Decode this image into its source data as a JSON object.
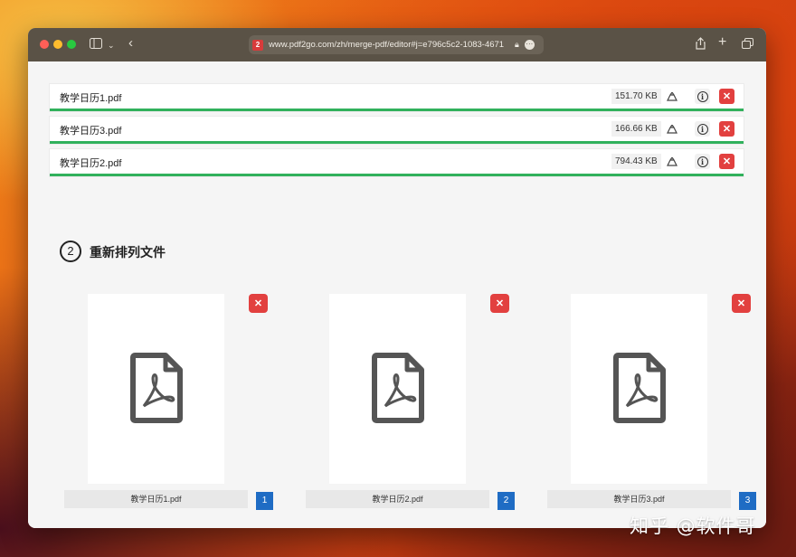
{
  "browser": {
    "url": "www.pdf2go.com/zh/merge-pdf/editor#j=e796c5c2-1083-4671",
    "favicon_text": "2"
  },
  "files": [
    {
      "name": "教学日历1.pdf",
      "size": "151.70 KB"
    },
    {
      "name": "教学日历3.pdf",
      "size": "166.66 KB"
    },
    {
      "name": "教学日历2.pdf",
      "size": "794.43 KB"
    }
  ],
  "reorder": {
    "step_number": "2",
    "title": "重新排列文件",
    "cards": [
      {
        "name": "教学日历1.pdf",
        "order": "1"
      },
      {
        "name": "教学日历2.pdf",
        "order": "2"
      },
      {
        "name": "教学日历3.pdf",
        "order": "3"
      }
    ]
  },
  "icons": {
    "delete": "✕",
    "info": "i",
    "cloud_drive": "cloud-upload-icon",
    "pdf": "pdf-file-icon"
  },
  "colors": {
    "accent_green": "#31b15c",
    "delete_red": "#e2403f",
    "order_blue": "#1f6cc4"
  },
  "watermark": "知乎 @软件哥"
}
